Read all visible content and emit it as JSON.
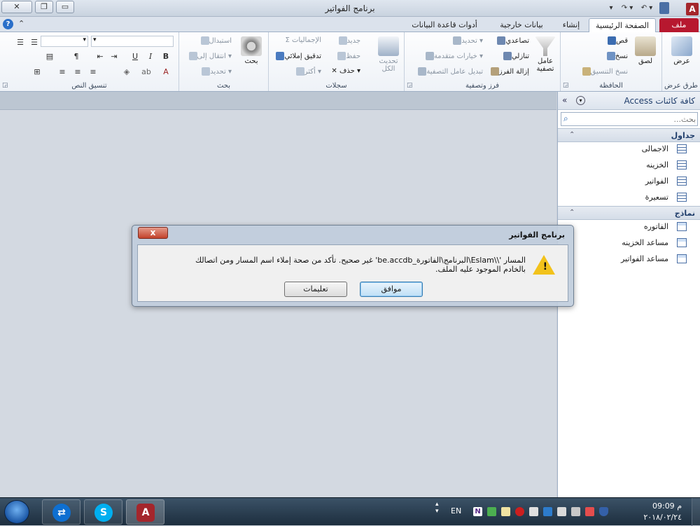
{
  "window": {
    "title": "برنامج الفواتير",
    "logo": "A"
  },
  "tabs": [
    {
      "label": "ملف"
    },
    {
      "label": "الصفحة الرئيسية"
    },
    {
      "label": "إنشاء"
    },
    {
      "label": "بيانات خارجية"
    },
    {
      "label": "أدوات قاعدة البيانات"
    }
  ],
  "ribbon": {
    "views": {
      "view_label": "عرض",
      "group_label": "طرق عرض"
    },
    "clipboard": {
      "paste": "لصق",
      "cut": "قص",
      "copy": "نسخ",
      "format_painter": "نسخ التنسيق",
      "group_label": "الحافظة"
    },
    "sort_filter": {
      "filter": "عامل تصفية",
      "ascending": "تصاعدي",
      "descending": "تنازلي",
      "remove_sort": "إزالة الفرز",
      "selection": "تحديد",
      "advanced": "خيارات متقدمة",
      "toggle_filter": "تبديل عامل التصفية",
      "group_label": "فرز وتصفية"
    },
    "records": {
      "refresh_all": "تحديث الكل",
      "new": "جديد",
      "save": "حفظ",
      "delete": "حذف",
      "totals": "الإجماليات",
      "spelling": "تدقيق إملائي",
      "more": "أكثر",
      "group_label": "سجلات"
    },
    "find": {
      "find": "بحث",
      "replace": "استبدال",
      "goto": "انتقال إلى",
      "select": "تحديد",
      "group_label": "بحث"
    },
    "text_format": {
      "group_label": "تنسيق النص",
      "bold": "B",
      "italic": "I",
      "underline": "U",
      "font_color": "A"
    }
  },
  "nav": {
    "title": "كافة كائنات Access",
    "search_placeholder": "بحث...",
    "tables_label": "جداول",
    "tables": [
      {
        "label": "الاجمالى"
      },
      {
        "label": "الخزينه"
      },
      {
        "label": "الفواتير"
      },
      {
        "label": "تسعيرة"
      }
    ],
    "forms_label": "نماذج",
    "forms": [
      {
        "label": "الفاتوره"
      },
      {
        "label": "مساعد الخزينه"
      },
      {
        "label": "مساعد الفواتير"
      }
    ]
  },
  "dialog": {
    "title": "برنامج الفواتير",
    "message": "المسار '\\\\Eslam\\البرنامج\\الفاتورة_be.accdb' غير صحيح. تأكد من صحة إملاء اسم المسار ومن اتصالك بالخادم الموجود عليه الملف.",
    "ok": "موافق",
    "help": "تعليمات",
    "close": "x"
  },
  "taskbar": {
    "lang": "EN",
    "time": "09:09 م",
    "date": "٢٠١٨/٠٢/٢٤",
    "apps": [
      {
        "name": "teamviewer"
      },
      {
        "name": "skype"
      },
      {
        "name": "access"
      }
    ]
  },
  "colors": {
    "file_tab": "#b7182f",
    "accent": "#2a6fc9",
    "warning": "#f2c21b"
  }
}
